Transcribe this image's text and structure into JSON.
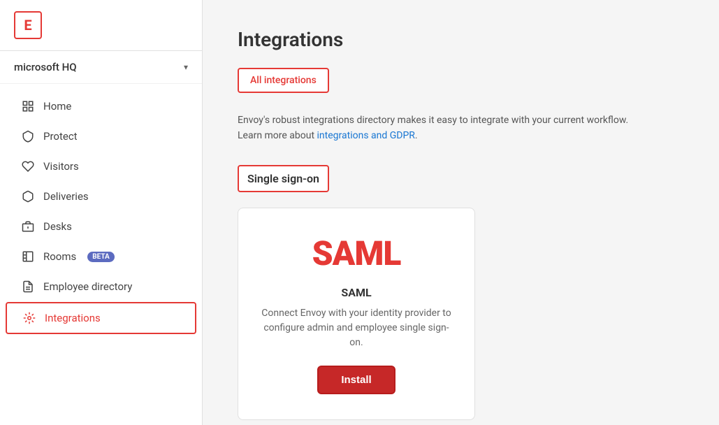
{
  "sidebar": {
    "logo_letter": "E",
    "workspace_name": "microsoft HQ",
    "chevron": "▾",
    "nav_items": [
      {
        "id": "home",
        "label": "Home",
        "icon": "▦"
      },
      {
        "id": "protect",
        "label": "Protect",
        "icon": "🛡"
      },
      {
        "id": "visitors",
        "label": "Visitors",
        "icon": "✋"
      },
      {
        "id": "deliveries",
        "label": "Deliveries",
        "icon": "📦"
      },
      {
        "id": "desks",
        "label": "Desks",
        "icon": "🗃"
      },
      {
        "id": "rooms",
        "label": "Rooms",
        "icon": "🪑",
        "badge": "BETA"
      },
      {
        "id": "employee-directory",
        "label": "Employee directory",
        "icon": "📋"
      },
      {
        "id": "integrations",
        "label": "Integrations",
        "icon": "✳",
        "active": true
      }
    ]
  },
  "main": {
    "page_title": "Integrations",
    "tab_label": "All integrations",
    "description_line1": "Envoy's robust integrations directory makes it easy to integrate with your current workflow.",
    "description_line2_prefix": "Learn more about ",
    "description_link": "integrations and GDPR",
    "description_line2_suffix": ".",
    "section_label": "Single sign-on",
    "card": {
      "logo": "SAML",
      "title": "SAML",
      "description": "Connect Envoy with your identity provider to configure admin and employee single sign-on.",
      "button_label": "Install"
    }
  }
}
